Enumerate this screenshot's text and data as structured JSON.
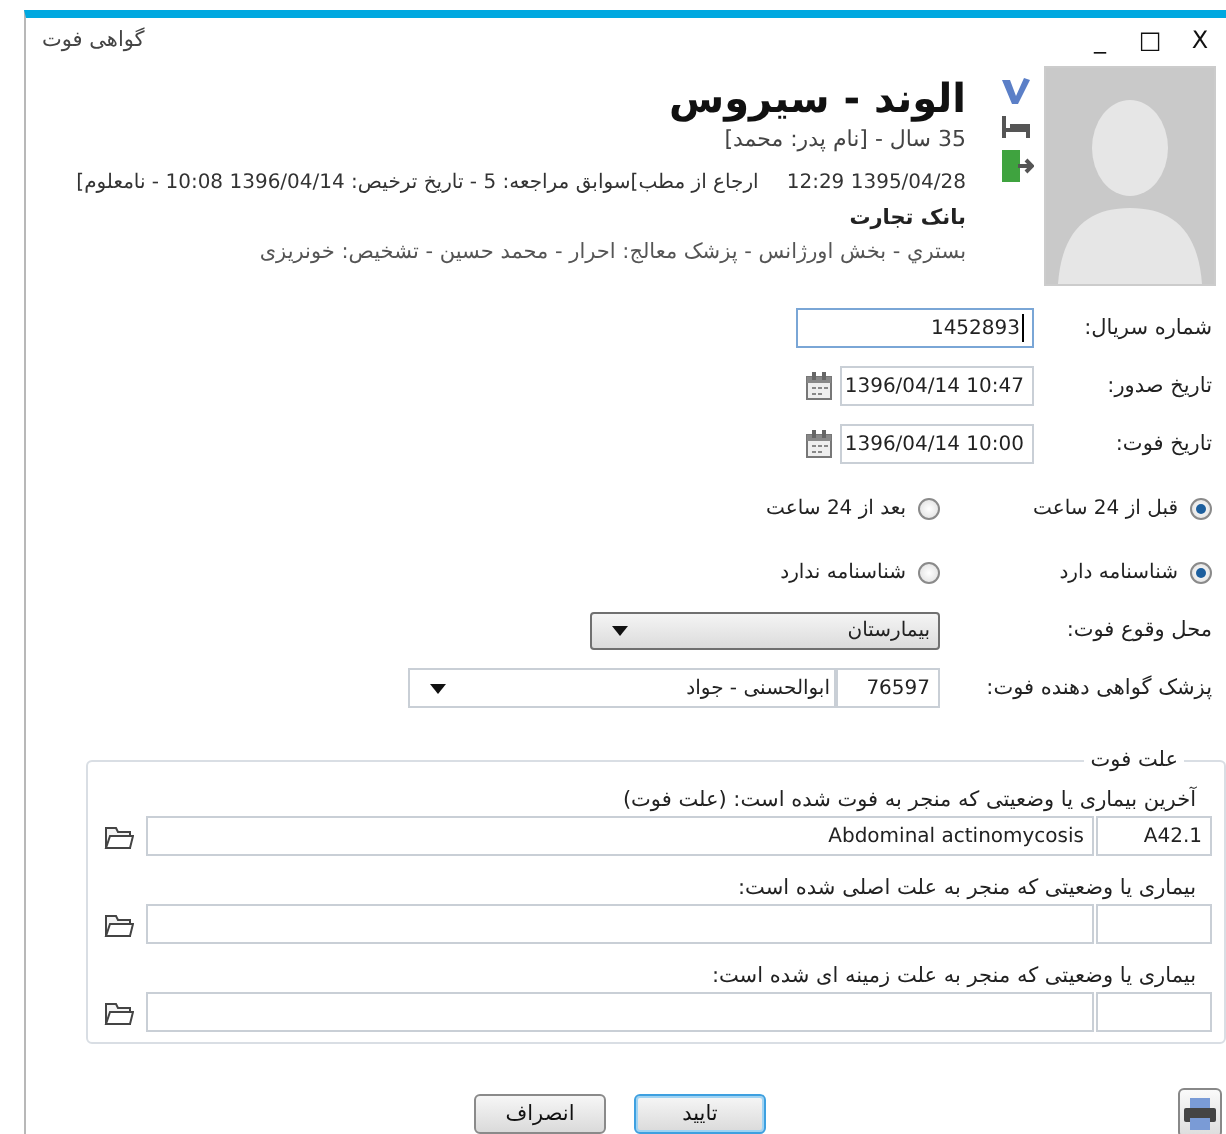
{
  "window": {
    "title": "گواهی فوت",
    "controls": [
      "X",
      "□",
      "_"
    ]
  },
  "patient": {
    "name": "الوند - سیروس",
    "age_father": "35 سال - [نام پدر: محمد]",
    "admission": "1395/04/28 12:29",
    "history": "ارجاع از مطب]سوابق مراجعه: 5 - تاریخ ترخیص: 1396/04/14 10:08 - نامعلوم]",
    "insurance": "بانک تجارت",
    "details": "بستري - بخش اورژانس -  پزشک معالج: احرار - محمد حسین -  تشخیص: خونریزی"
  },
  "form": [
    {
      "kind": "text",
      "label": "شماره سریال:",
      "value": "1452893",
      "focused": true
    },
    {
      "kind": "date",
      "label": "تاریخ صدور:",
      "value": "1396/04/14 10:47"
    },
    {
      "kind": "date",
      "label": "تاریخ فوت:",
      "value": "1396/04/14 10:00"
    },
    {
      "kind": "radio",
      "options": [
        {
          "label": "قبل از 24 ساعت",
          "selected": true
        },
        {
          "label": "بعد از 24 ساعت",
          "selected": false
        }
      ]
    },
    {
      "kind": "radio",
      "options": [
        {
          "label": "شناسنامه دارد",
          "selected": true
        },
        {
          "label": "شناسنامه ندارد",
          "selected": false
        }
      ]
    },
    {
      "kind": "select",
      "label": "محل وقوع فوت:",
      "value": "بیمارستان"
    },
    {
      "kind": "doctor",
      "label": "پزشک گواهی دهنده فوت:",
      "code": "76597",
      "value": "ابوالحسنی - جواد"
    }
  ],
  "cause": {
    "legend": "علت فوت",
    "items": [
      {
        "label": "آخرین بیماری یا وضعیتی که منجر به فوت شده است: (علت فوت)",
        "code": "A42.1",
        "description": "Abdominal actinomycosis"
      },
      {
        "label": "بیماری یا وضعیتی که منجر به علت اصلی شده است:"
      },
      {
        "label": "بیماری یا وضعیتی که منجر به علت زمینه ای شده است:"
      }
    ]
  },
  "buttons": [
    {
      "label": "تایید",
      "default": true
    },
    {
      "label": "انصراف",
      "default": false
    }
  ]
}
